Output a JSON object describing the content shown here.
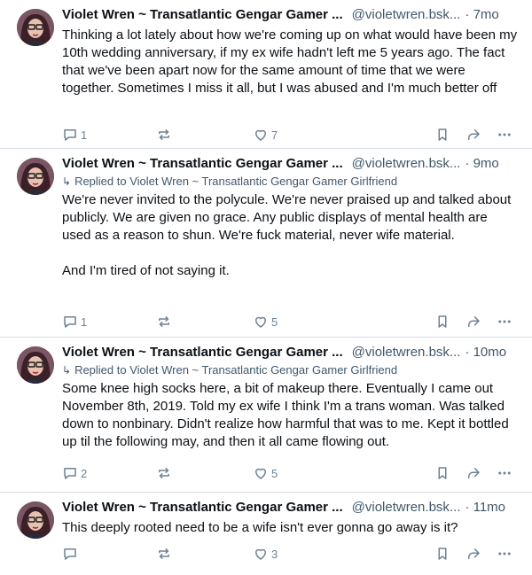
{
  "posts": [
    {
      "name": "Violet Wren ~ Transatlantic Gengar Gamer ...",
      "handle": "@violetwren.bsk...",
      "time": "· 7mo",
      "reply_to": "",
      "paragraphs": [
        "Thinking a lot lately about how we're coming up on what would have been my 10th wedding anniversary, if my ex wife hadn't left me 5 years ago. The fact that we've been apart now for the same amount of time that we were together. Sometimes I miss it all, but I was abused and I'm much better off"
      ],
      "replies": "1",
      "reposts": "",
      "likes": "7"
    },
    {
      "name": "Violet Wren ~ Transatlantic Gengar Gamer ...",
      "handle": "@violetwren.bsk...",
      "time": "· 9mo",
      "reply_to": "Replied to Violet Wren ~ Transatlantic Gengar Gamer Girlfriend",
      "paragraphs": [
        "We're never invited to the polycule. We're never praised up and talked about publicly. We are given no grace. Any public displays of mental health are used as a reason to shun. We're fuck material, never wife material.",
        "And I'm tired of not saying it."
      ],
      "replies": "1",
      "reposts": "",
      "likes": "5"
    },
    {
      "name": "Violet Wren ~ Transatlantic Gengar Gamer ...",
      "handle": "@violetwren.bsk...",
      "time": "· 10mo",
      "reply_to": "Replied to Violet Wren ~ Transatlantic Gengar Gamer Girlfriend",
      "paragraphs": [
        "Some knee high socks here, a bit of makeup there. Eventually I came out November 8th, 2019. Told my ex wife I think I'm a trans woman. Was talked down to nonbinary. Didn't realize how harmful that was to me. Kept it bottled up til the following may, and then it all came flowing out."
      ],
      "replies": "2",
      "reposts": "",
      "likes": "5"
    },
    {
      "name": "Violet Wren ~ Transatlantic Gengar Gamer ...",
      "handle": "@violetwren.bsk...",
      "time": "· 11mo",
      "reply_to": "",
      "paragraphs": [
        "This deeply rooted need to be a wife isn't ever gonna go away is it?"
      ],
      "replies": "",
      "reposts": "",
      "likes": "3"
    }
  ],
  "icons": {
    "reply": "reply-icon",
    "repost": "repost-icon",
    "like": "heart-icon",
    "bookmark": "bookmark-icon",
    "share": "share-icon",
    "more": "more-icon"
  },
  "colors": {
    "text": "#0b0f14",
    "muted": "#42576c",
    "icon": "#6f8296",
    "divider": "#d4dbe2"
  }
}
